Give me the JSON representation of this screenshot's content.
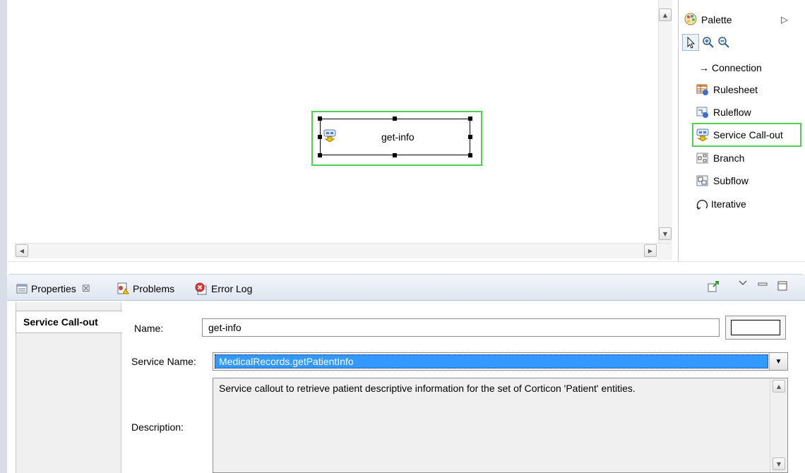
{
  "canvas": {
    "node": {
      "label": "get-info",
      "icon": "service-callout-icon"
    }
  },
  "palette": {
    "title": "Palette",
    "items": [
      {
        "label": "Connection",
        "icon": "arrow-right-icon"
      },
      {
        "label": "Rulesheet",
        "icon": "rulesheet-icon"
      },
      {
        "label": "Ruleflow",
        "icon": "ruleflow-icon"
      },
      {
        "label": "Service Call-out",
        "icon": "service-callout-icon",
        "selected": true
      },
      {
        "label": "Branch",
        "icon": "branch-icon"
      },
      {
        "label": "Subflow",
        "icon": "subflow-icon"
      },
      {
        "label": "Iterative",
        "icon": "iterative-icon"
      }
    ],
    "connection_glyph": "→"
  },
  "properties": {
    "tabs": [
      {
        "label": "Properties",
        "close": "☒",
        "icon": "properties-icon"
      },
      {
        "label": "Problems",
        "icon": "problems-icon"
      },
      {
        "label": "Error Log",
        "icon": "error-log-icon"
      }
    ],
    "section_tab": "Service Call-out",
    "name_label": "Name:",
    "name_value": "get-info",
    "service_name_label": "Service Name:",
    "service_name_value": "MedicalRecords.getPatientInfo",
    "description_label": "Description:",
    "description_value": "Service callout to retrieve patient descriptive information for the set of Corticon 'Patient' entities."
  },
  "colors": {
    "selection_highlight": "#4fd24f",
    "selected_value_bg": "#3399ff"
  }
}
